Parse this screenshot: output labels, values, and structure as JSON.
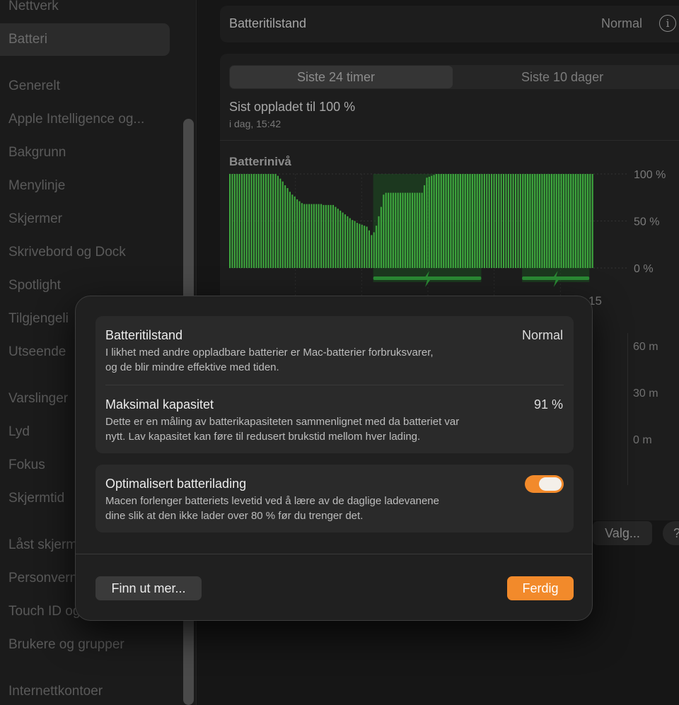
{
  "sidebar": {
    "items": [
      {
        "label": "Nettverk"
      },
      {
        "label": "Batteri"
      },
      {
        "label": "Generelt"
      },
      {
        "label": "Apple Intelligence og..."
      },
      {
        "label": "Bakgrunn"
      },
      {
        "label": "Menylinje"
      },
      {
        "label": "Skjermer"
      },
      {
        "label": "Skrivebord og Dock"
      },
      {
        "label": "Spotlight"
      },
      {
        "label": "Tilgjengeli"
      },
      {
        "label": "Utseende"
      },
      {
        "label": "Varslinger"
      },
      {
        "label": "Lyd"
      },
      {
        "label": "Fokus"
      },
      {
        "label": "Skjermtid"
      },
      {
        "label": "Låst skjerm"
      },
      {
        "label": "Personvern"
      },
      {
        "label": "Touch ID og"
      },
      {
        "label": "Brukere og grupper"
      },
      {
        "label": "Internettkontoer"
      }
    ]
  },
  "main": {
    "health_row": {
      "label": "Batteritilstand",
      "value": "Normal"
    },
    "range_tabs": [
      "Siste 24 timer",
      "Siste 10 dager"
    ],
    "last_charged": {
      "title": "Sist oppladet til 100 %",
      "time": "i dag, 15:42"
    },
    "battery_level": {
      "title": "Batterinivå"
    },
    "partial_time_label": "15",
    "usage_axis": [
      "60 m",
      "30 m",
      "0 m"
    ],
    "options_button": "Valg...",
    "help_button": "?"
  },
  "chart_data": {
    "type": "bar",
    "title": "Batterinivå",
    "yticks": [
      "100 %",
      "50 %",
      "0 %"
    ],
    "ylim": [
      0,
      100
    ],
    "values": [
      100,
      100,
      100,
      100,
      100,
      100,
      100,
      100,
      100,
      100,
      100,
      100,
      100,
      100,
      100,
      100,
      100,
      100,
      100,
      100,
      98,
      95,
      92,
      88,
      85,
      81,
      78,
      76,
      73,
      71,
      69,
      68,
      68,
      68,
      68,
      68,
      68,
      68,
      68,
      67,
      67,
      67,
      67,
      67,
      65,
      63,
      61,
      59,
      57,
      55,
      53,
      51,
      50,
      48,
      47,
      46,
      45,
      44,
      40,
      35,
      38,
      45,
      55,
      65,
      78,
      80,
      80,
      80,
      80,
      80,
      80,
      80,
      80,
      80,
      80,
      80,
      80,
      80,
      80,
      80,
      80,
      88,
      96,
      97,
      98,
      99,
      100,
      100,
      100,
      100,
      100,
      100,
      100,
      100,
      100,
      100,
      100,
      100,
      100,
      100,
      100,
      100,
      100,
      100,
      100,
      100,
      100,
      100,
      100,
      100,
      100,
      100,
      100,
      100,
      100,
      100,
      100,
      100,
      100,
      100,
      100,
      100,
      100,
      100,
      100,
      100,
      100,
      100,
      100,
      100,
      100,
      100,
      100,
      100,
      100,
      100,
      100,
      100,
      100,
      100,
      100,
      100,
      100,
      100,
      100,
      100,
      100,
      100,
      100,
      100,
      100,
      100
    ],
    "charging_periods": [
      [
        60,
        105
      ],
      [
        122,
        150
      ]
    ],
    "grid": true
  },
  "dialog": {
    "health": {
      "title": "Batteritilstand",
      "value": "Normal",
      "desc1": "I likhet med andre oppladbare batterier er Mac-batterier forbruksvarer,",
      "desc2": "og de blir mindre effektive med tiden."
    },
    "capacity": {
      "title": "Maksimal kapasitet",
      "value": "91 %",
      "desc1": "Dette er en måling av batterikapasiteten sammenlignet med da batteriet var",
      "desc2": "nytt. Lav kapasitet kan føre til redusert brukstid mellom hver lading."
    },
    "optimized": {
      "title": "Optimalisert batterilading",
      "enabled": true,
      "desc1": "Macen forlenger batteriets levetid ved å lære av de daglige ladevanene",
      "desc2": "dine slik at den ikke lader over 80 % før du trenger det."
    },
    "learn_more": "Finn ut mer...",
    "done": "Ferdig"
  },
  "colors": {
    "accent": "#f28a2b",
    "bar": "#3ea83e",
    "charging_band": "#1d5a24",
    "charging_icon": "#2a8a34"
  }
}
